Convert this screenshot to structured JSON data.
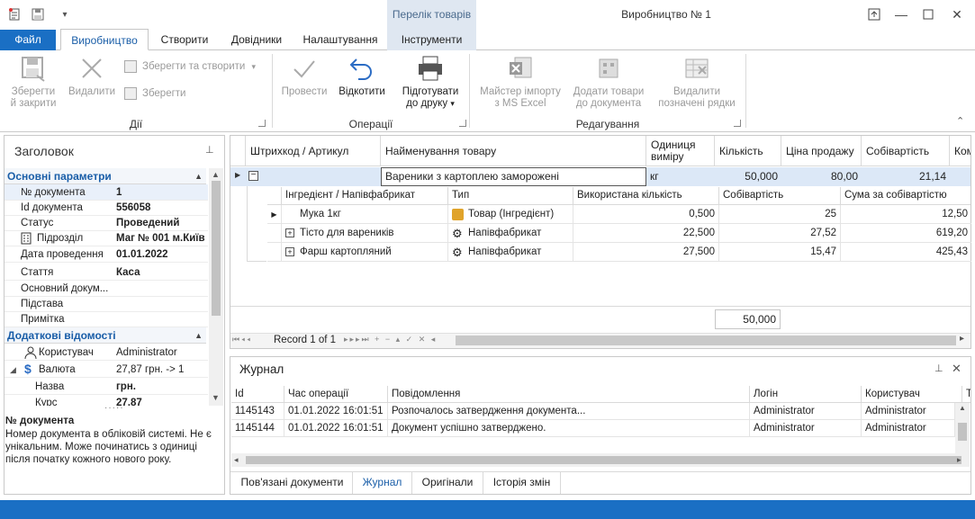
{
  "window": {
    "title": "Виробництво № 1",
    "context_tab_header": "Перелік товарів"
  },
  "tabs": {
    "file": "Файл",
    "items": [
      "Виробництво",
      "Створити",
      "Довідники",
      "Налаштування",
      "Інструменти"
    ]
  },
  "ribbon": {
    "save_close": [
      "Зберегти",
      "й закрити"
    ],
    "delete": "Видалити",
    "save_create": "Зберегти та створити",
    "save": "Зберегти",
    "group_actions": "Дії",
    "post": "Провести",
    "undo": "Відкотити",
    "print": [
      "Підготувати",
      "до друку"
    ],
    "group_operations": "Операції",
    "import_excel": [
      "Майстер імпорту",
      "з MS Excel"
    ],
    "add_goods": [
      "Додати товари",
      "до документа"
    ],
    "delete_marked": [
      "Видалити",
      "позначені рядки"
    ],
    "group_edit": "Редагування"
  },
  "left_panel": {
    "title": "Заголовок",
    "section_main": "Основні параметри",
    "rows": [
      {
        "k": "№ документа",
        "v": "1"
      },
      {
        "k": "Id документа",
        "v": "556058"
      },
      {
        "k": "Статус",
        "v": "Проведений"
      },
      {
        "k": "Підрозділ",
        "v": "Маг № 001 м.Київ"
      },
      {
        "k": "Дата проведення",
        "v": "01.01.2022"
      },
      {
        "k": "Стаття",
        "v": "Каса"
      },
      {
        "k": "Основний докум...",
        "v": ""
      },
      {
        "k": "Підстава",
        "v": ""
      },
      {
        "k": "Примітка",
        "v": ""
      }
    ],
    "section_extra": "Додаткові відомості",
    "extra_rows": [
      {
        "k": "Користувач",
        "v": "Administrator"
      },
      {
        "k": "Валюта",
        "v": "27,87 грн. -> 1"
      },
      {
        "k": "Назва",
        "v": "грн."
      },
      {
        "k": "Курс",
        "v": "27,87"
      }
    ],
    "desc_title": "№ документа",
    "desc_body": "Номер документа в обліковій системі. Не є унікальним. Може починатись з одиниці після початку кожного нового року."
  },
  "grid": {
    "headers": [
      "Штрихкод / Артикул",
      "Найменування товару",
      "Одиниця виміру",
      "Кількість",
      "Ціна продажу",
      "Собівартість",
      "Ком"
    ],
    "main_row": {
      "name": "Вареники з картоплею заморожені",
      "unit": "кг",
      "qty": "50,000",
      "price": "80,00",
      "cost": "21,14"
    },
    "sub_headers": [
      "Інгредієнт / Напівфабрикат",
      "Тип",
      "Використана кількість",
      "Собівартість",
      "Сума за собівартістю"
    ],
    "sub_rows": [
      {
        "name": "Мука 1кг",
        "type": "Товар (Інгредієнт)",
        "used": "0,500",
        "cost": "25",
        "sum": "12,50"
      },
      {
        "name": "Тісто для вареників",
        "type": "Напівфабрикат",
        "used": "22,500",
        "cost": "27,52",
        "sum": "619,20"
      },
      {
        "name": "Фарш картопляний",
        "type": "Напівфабрикат",
        "used": "27,500",
        "cost": "15,47",
        "sum": "425,43"
      }
    ],
    "total_qty": "50,000",
    "record_nav": "Record 1 of 1"
  },
  "journal": {
    "title": "Журнал",
    "headers": [
      "Id",
      "Час операції",
      "Повідомлення",
      "Логін",
      "Користувач",
      "Т"
    ],
    "rows": [
      {
        "id": "1145143",
        "time": "01.01.2022 16:01:51",
        "msg": "Розпочалось затвердження документа...",
        "login": "Administrator",
        "user": "Administrator"
      },
      {
        "id": "1145144",
        "time": "01.01.2022 16:01:51",
        "msg": "Документ успішно затверджено.",
        "login": "Administrator",
        "user": "Administrator"
      }
    ]
  },
  "bottom_tabs": [
    "Пов'язані документи",
    "Журнал",
    "Оригінали",
    "Історія змін"
  ],
  "colors": {
    "accent": "#1a6fc4",
    "link": "#1a5ea8",
    "selected_row": "#dce8f7"
  }
}
